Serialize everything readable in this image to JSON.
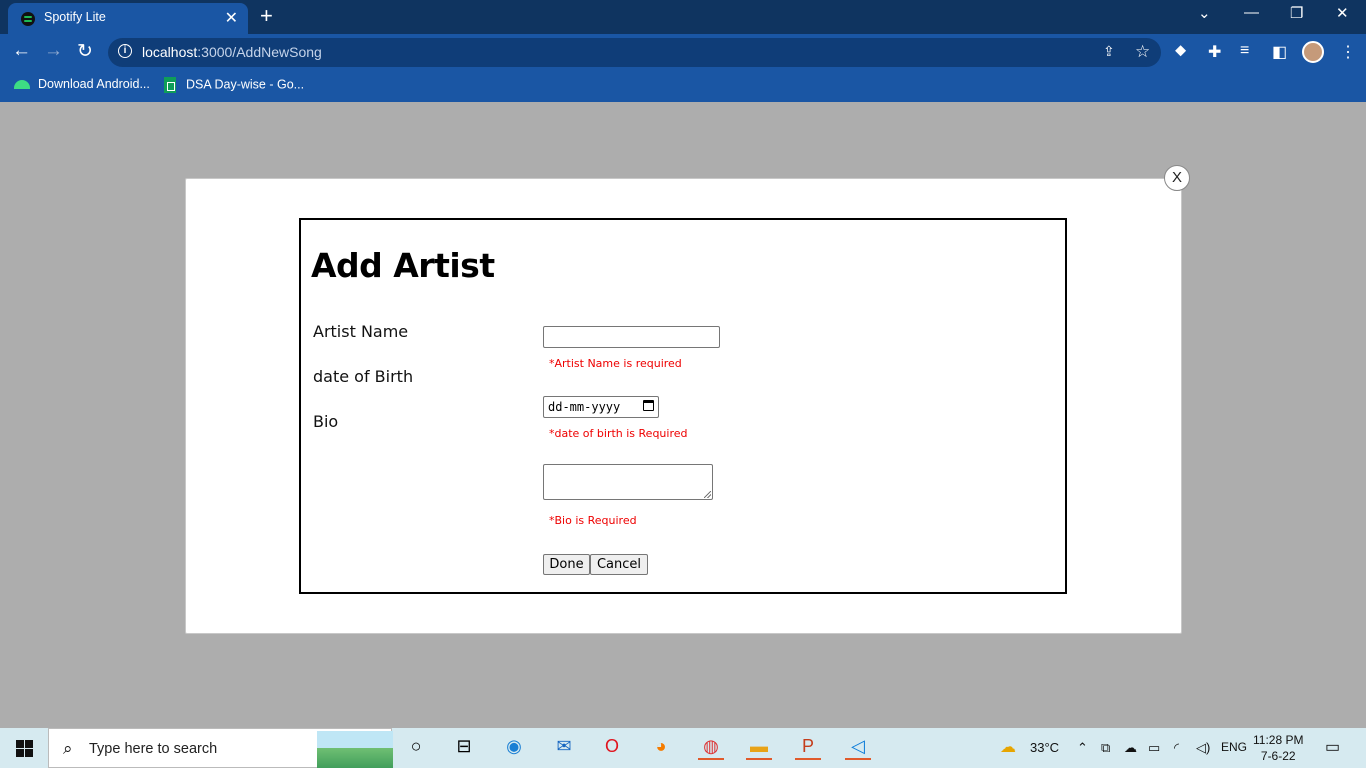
{
  "browser": {
    "tab_title": "Spotify Lite",
    "tab_close": "✕",
    "new_tab": "+",
    "window_controls": {
      "list": "⌄",
      "minimize": "—",
      "restore": "❐",
      "close": "✕"
    },
    "nav": {
      "back": "←",
      "forward": "→",
      "reload": "↻"
    },
    "address": {
      "host": "localhost",
      "path": ":3000/AddNewSong",
      "info": "i"
    },
    "bookmarks": [
      {
        "label": "Download Android..."
      },
      {
        "label": "DSA Day-wise - Go..."
      }
    ]
  },
  "modal": {
    "close_label": "X",
    "title": "Add Artist",
    "fields": {
      "artist_name_label": "Artist Name",
      "dob_label": "date of Birth",
      "bio_label": "Bio",
      "artist_name_value": "",
      "dob_placeholder": "dd-mm-yyyy",
      "bio_value": ""
    },
    "errors": {
      "artist_name": "*Artist Name is required",
      "dob": "*date of birth is Required",
      "bio": "*Bio is Required"
    },
    "buttons": {
      "done": "Done",
      "cancel": "Cancel"
    }
  },
  "taskbar": {
    "search_placeholder": "Type here to search",
    "weather": "33°C",
    "language": "ENG",
    "time": "11:28 PM",
    "date": "7-6-22"
  }
}
